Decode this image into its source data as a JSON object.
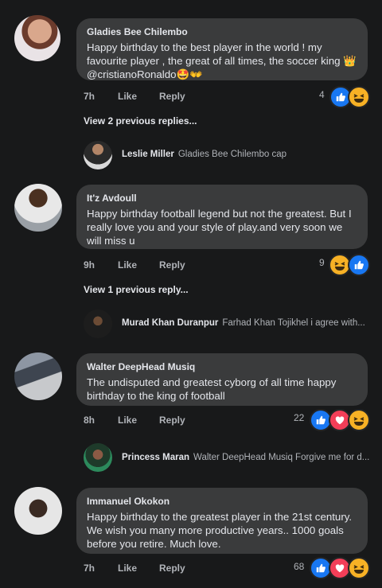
{
  "comments": [
    {
      "author": "Gladies Bee Chilembo",
      "text": "Happy birthday to the best player in the world ! my favourite player , the great of all times, the soccer king 👑 @cristianoRonaldo🤩👐",
      "time": "7h",
      "like_label": "Like",
      "reply_label": "Reply",
      "reaction_count": "4",
      "reactions": [
        "like",
        "haha"
      ],
      "view_replies": "View 2 previous replies...",
      "reply_preview": {
        "name": "Leslie Miller",
        "text": "Gladies Bee Chilembo cap"
      }
    },
    {
      "author": "It'z Avdoull",
      "text": "Happy birthday football legend but not the greatest. But I really love you and your style of play.and very soon we will miss u",
      "time": "9h",
      "like_label": "Like",
      "reply_label": "Reply",
      "reaction_count": "9",
      "reactions": [
        "haha",
        "like"
      ],
      "view_replies": "View 1 previous reply...",
      "reply_preview": {
        "name": "Murad Khan Duranpur",
        "text": "Farhad Khan Tojikhel i agree with..."
      }
    },
    {
      "author": "Walter DeepHead Musiq",
      "text": "The undisputed and greatest cyborg of all time happy birthday to the king of football",
      "time": "8h",
      "like_label": "Like",
      "reply_label": "Reply",
      "reaction_count": "22",
      "reactions": [
        "like",
        "love",
        "haha"
      ],
      "reply_preview": {
        "name": "Princess Maran",
        "text": "Walter DeepHead Musiq Forgive me for d..."
      }
    },
    {
      "author": "Immanuel Okokon",
      "text": "Happy birthday to the greatest player in the 21st century. We wish you many more productive years.. 1000 goals before you retire. Much love.",
      "time": "7h",
      "like_label": "Like",
      "reply_label": "Reply",
      "reaction_count": "68",
      "reactions": [
        "like",
        "love",
        "haha"
      ]
    }
  ]
}
